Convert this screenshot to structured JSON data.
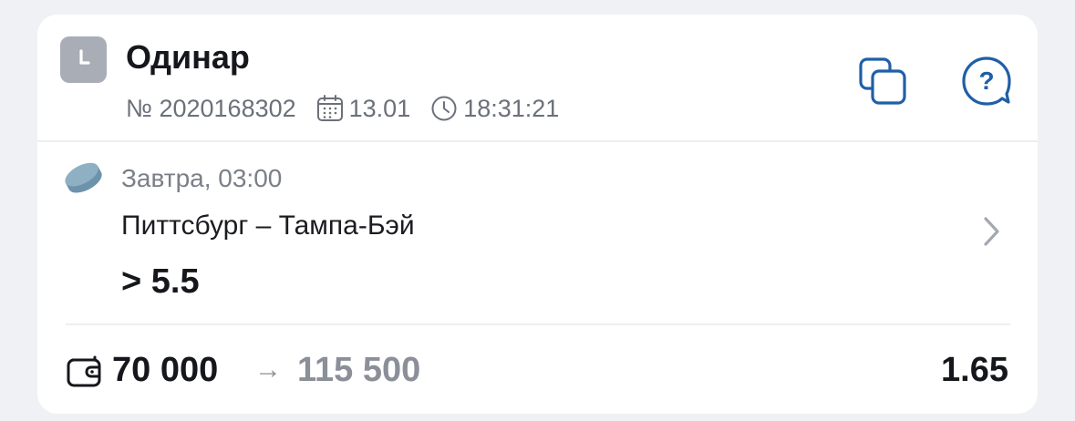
{
  "bet": {
    "type_icon": "clock-icon",
    "title": "Одинар",
    "number": "№ 2020168302",
    "date_icon": "calendar-icon",
    "date": "13.01",
    "time_icon": "clock-outline-icon",
    "time": "18:31:21",
    "actions": {
      "copy_icon": "copy-icon",
      "help_icon": "help-question-icon",
      "help_glyph": "?"
    }
  },
  "event": {
    "sport_icon": "hockey-puck-icon",
    "start_time": "Завтра, 03:00",
    "teams": "Питтсбург – Тампа-Бэй",
    "outcome": "> 5.5",
    "chevron_icon": "chevron-right-icon"
  },
  "footer": {
    "wallet_icon": "wallet-icon",
    "stake": "70 000",
    "arrow": "→",
    "payout": "115 500",
    "odds": "1.65"
  },
  "colors": {
    "background": "#f0f1f4",
    "card": "#ffffff",
    "accent_blue": "#1f5fa8",
    "muted_text": "#7a7f88",
    "type_icon_bg": "#a9adb6",
    "puck": "#7fa3b8"
  }
}
